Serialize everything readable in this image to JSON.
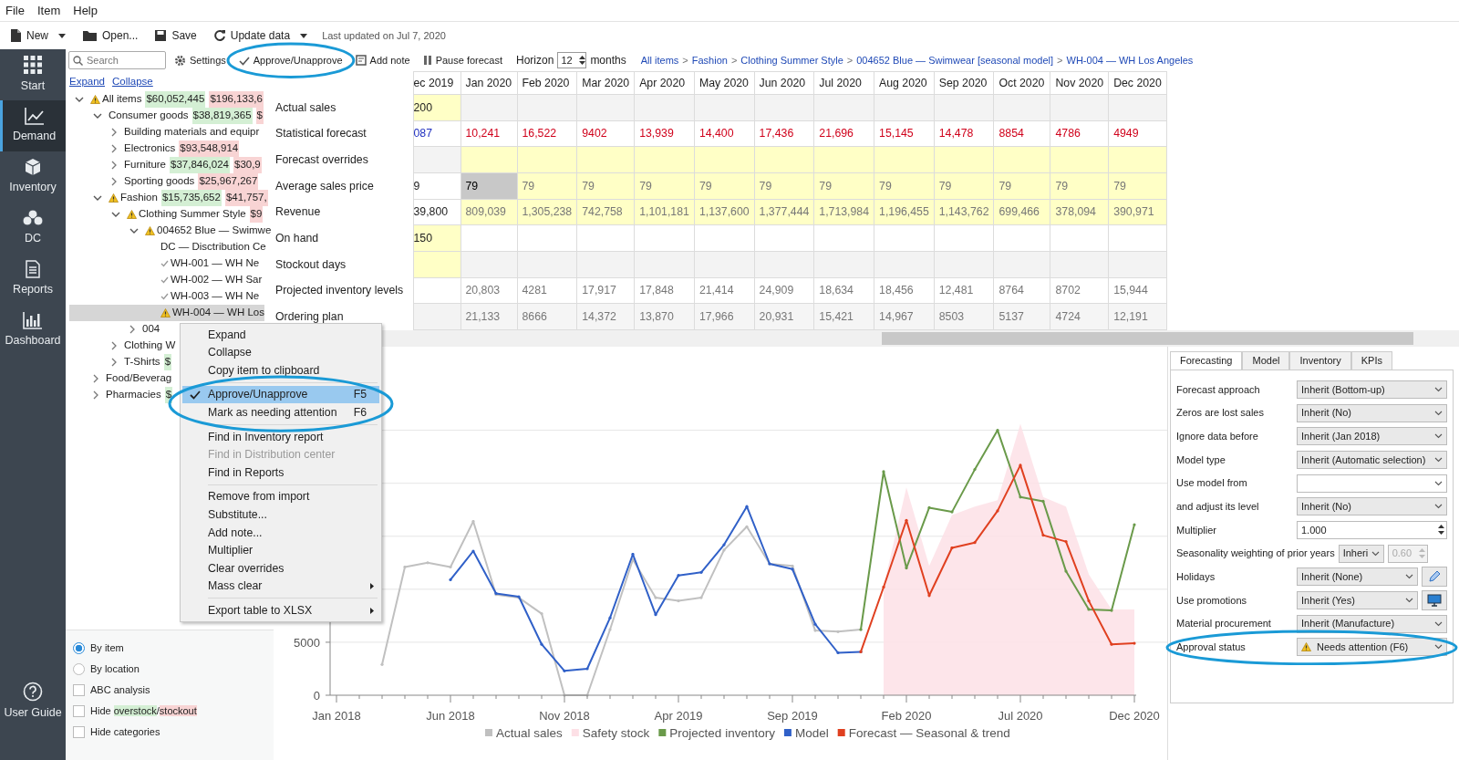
{
  "menu_bar": [
    "File",
    "Item",
    "Help"
  ],
  "toolbar": {
    "buttons": [
      {
        "label": "New",
        "dropdown": true
      },
      {
        "label": "Open...",
        "dropdown": false
      },
      {
        "label": "Save",
        "dropdown": false
      },
      {
        "label": "Update data",
        "dropdown": true
      }
    ],
    "last_updated": "Last updated on Jul 7, 2020"
  },
  "sidebar": {
    "items": [
      {
        "label": "Start",
        "selected": false
      },
      {
        "label": "Demand",
        "selected": true
      },
      {
        "label": "Inventory",
        "selected": false
      },
      {
        "label": "DC",
        "selected": false
      },
      {
        "label": "Reports",
        "selected": false
      },
      {
        "label": "Dashboard",
        "selected": false
      }
    ],
    "footer": {
      "label": "User Guide"
    }
  },
  "action_bar": {
    "search": {
      "placeholder": "Search"
    },
    "actions": [
      {
        "label": "Settings"
      },
      {
        "label": "Approve/Unapprove"
      },
      {
        "label": "Add note"
      },
      {
        "label": "Pause forecast"
      }
    ],
    "horizon": {
      "label": "Horizon",
      "value": "12",
      "unit": "months"
    },
    "breadcrumbs": [
      {
        "kind": "link",
        "text": "All items"
      },
      {
        "kind": "sep",
        "text": ">"
      },
      {
        "kind": "link",
        "text": "Fashion"
      },
      {
        "kind": "sep",
        "text": ">"
      },
      {
        "kind": "link",
        "text": "Clothing Summer Style"
      },
      {
        "kind": "sep",
        "text": ">"
      },
      {
        "kind": "link",
        "text": "004652 Blue — Swimwear [seasonal model]"
      },
      {
        "kind": "sep",
        "text": ">"
      },
      {
        "kind": "link",
        "text": "WH-004 — WH Los Angeles"
      }
    ]
  },
  "tree": {
    "links": [
      "Expand",
      "Collapse"
    ],
    "items": [
      {
        "label": "All items",
        "attention": true,
        "approved": false,
        "expanded": true,
        "selected": false,
        "badges": [
          {
            "text": "$60,052,445",
            "color": "#d4efd4"
          },
          {
            "text": "$196,133,6",
            "color": "#f8d4d4"
          }
        ],
        "children": [
          {
            "label": "Consumer goods",
            "attention": false,
            "approved": false,
            "expanded": true,
            "selected": false,
            "badges": [
              {
                "text": "$38,819,365",
                "color": "#d4efd4"
              },
              {
                "text": "$",
                "color": "#f8d4d4"
              }
            ],
            "children": [
              {
                "label": "Building materials and equipr",
                "attention": false,
                "approved": false,
                "expanded": false,
                "selected": false
              },
              {
                "label": "Electronics",
                "attention": false,
                "approved": false,
                "expanded": false,
                "selected": false,
                "badges": [
                  {
                    "text": "$93,548,914",
                    "color": "#f8d4d4"
                  }
                ]
              },
              {
                "label": "Furniture",
                "attention": false,
                "approved": false,
                "expanded": false,
                "selected": false,
                "badges": [
                  {
                    "text": "$37,846,024",
                    "color": "#d4efd4"
                  },
                  {
                    "text": "$30,9",
                    "color": "#f8d4d4"
                  }
                ]
              },
              {
                "label": "Sporting goods",
                "attention": false,
                "approved": false,
                "expanded": false,
                "selected": false,
                "badges": [
                  {
                    "text": "$25,967,267",
                    "color": "#f8d4d4"
                  }
                ]
              }
            ]
          },
          {
            "label": "Fashion",
            "attention": true,
            "approved": false,
            "expanded": true,
            "selected": false,
            "badges": [
              {
                "text": "$15,735,652",
                "color": "#d4efd4"
              },
              {
                "text": "$41,757,",
                "color": "#f8d4d4"
              }
            ],
            "children": [
              {
                "label": "Clothing Summer Style",
                "attention": true,
                "approved": false,
                "expanded": true,
                "selected": false,
                "badges": [
                  {
                    "text": "$9",
                    "color": "#f8d4d4"
                  }
                ],
                "children": [
                  {
                    "label": "004652 Blue — Swimwe",
                    "attention": true,
                    "approved": false,
                    "expanded": true,
                    "selected": false,
                    "children": [
                      {
                        "label": "DC — Disctribution Ce",
                        "attention": false,
                        "approved": false,
                        "selected": false
                      },
                      {
                        "label": "WH-001 — WH Ne",
                        "attention": false,
                        "approved": true,
                        "selected": false
                      },
                      {
                        "label": "WH-002 — WH Sar",
                        "attention": false,
                        "approved": true,
                        "selected": false
                      },
                      {
                        "label": "WH-003 — WH Ne",
                        "attention": false,
                        "approved": true,
                        "selected": false
                      },
                      {
                        "label": "WH-004 — WH Los",
                        "attention": true,
                        "approved": false,
                        "selected": true
                      }
                    ]
                  },
                  {
                    "label": "004",
                    "attention": false,
                    "approved": false,
                    "expanded": false,
                    "selected": false
                  }
                ]
              },
              {
                "label": "Clothing W",
                "attention": false,
                "approved": false,
                "expanded": false,
                "selected": false
              },
              {
                "label": "T-Shirts",
                "attention": false,
                "approved": false,
                "expanded": false,
                "selected": false,
                "badges": [
                  {
                    "text": "$",
                    "color": "#d4efd4"
                  }
                ]
              }
            ]
          },
          {
            "label": "Food/Beverag",
            "attention": false,
            "approved": false,
            "expanded": false,
            "selected": false
          },
          {
            "label": "Pharmacies",
            "attention": false,
            "approved": false,
            "expanded": false,
            "selected": false,
            "badges": [
              {
                "text": "$",
                "color": "#d4efd4"
              }
            ]
          }
        ]
      }
    ]
  },
  "view_options": [
    {
      "kind": "radio",
      "label": [
        {
          "text": "By item"
        }
      ],
      "checked": true
    },
    {
      "kind": "radio",
      "label": [
        {
          "text": "By location"
        }
      ],
      "checked": false
    },
    {
      "kind": "checkbox",
      "label": [
        {
          "text": "ABC analysis"
        }
      ],
      "checked": false
    },
    {
      "kind": "checkbox",
      "label": [
        {
          "text": "Hide "
        },
        {
          "text": "overstock",
          "color": "#d4efd4"
        },
        {
          "text": "/"
        },
        {
          "text": "stockout",
          "color": "#f8d4d4"
        }
      ],
      "checked": false
    },
    {
      "kind": "checkbox",
      "label": [
        {
          "text": "Hide categories"
        }
      ],
      "checked": false
    }
  ],
  "grid": {
    "columns": [
      "ec 2019",
      "Jan 2020",
      "Feb 2020",
      "Mar 2020",
      "Apr 2020",
      "May 2020",
      "Jun 2020",
      "Jul 2020",
      "Aug 2020",
      "Sep 2020",
      "Oct 2020",
      "Nov 2020",
      "Dec 2020"
    ],
    "rows": [
      {
        "label": "Actual sales",
        "kind": "actual",
        "cells": [
          {
            "text": "200",
            "selected": false
          },
          {
            "selected": false
          },
          {
            "selected": false
          },
          {
            "selected": false
          },
          {
            "selected": false
          },
          {
            "selected": false
          },
          {
            "selected": false
          },
          {
            "selected": false
          },
          {
            "selected": false
          },
          {
            "selected": false
          },
          {
            "selected": false
          },
          {
            "selected": false
          },
          {
            "selected": false
          }
        ]
      },
      {
        "label": "Statistical forecast",
        "kind": "forecast",
        "cells": [
          {
            "text": "087",
            "selected": false
          },
          {
            "text": "10,241",
            "selected": false
          },
          {
            "text": "16,522",
            "selected": false
          },
          {
            "text": "9402",
            "selected": false
          },
          {
            "text": "13,939",
            "selected": false
          },
          {
            "text": "14,400",
            "selected": false
          },
          {
            "text": "17,436",
            "selected": false
          },
          {
            "text": "21,696",
            "selected": false
          },
          {
            "text": "15,145",
            "selected": false
          },
          {
            "text": "14,478",
            "selected": false
          },
          {
            "text": "8854",
            "selected": false
          },
          {
            "text": "4786",
            "selected": false
          },
          {
            "text": "4949",
            "selected": false
          }
        ]
      },
      {
        "label": "Forecast overrides",
        "kind": "override",
        "cells": [
          {
            "selected": false
          },
          {
            "selected": false
          },
          {
            "selected": false
          },
          {
            "selected": false
          },
          {
            "selected": false
          },
          {
            "selected": false
          },
          {
            "selected": false
          },
          {
            "selected": false
          },
          {
            "selected": false
          },
          {
            "selected": false
          },
          {
            "selected": false
          },
          {
            "selected": false
          },
          {
            "selected": false
          }
        ]
      },
      {
        "label": "Average sales price",
        "kind": "price",
        "cells": [
          {
            "text": "9",
            "selected": false
          },
          {
            "text": "79",
            "selected": true
          },
          {
            "text": "79",
            "selected": false
          },
          {
            "text": "79",
            "selected": false
          },
          {
            "text": "79",
            "selected": false
          },
          {
            "text": "79",
            "selected": false
          },
          {
            "text": "79",
            "selected": false
          },
          {
            "text": "79",
            "selected": false
          },
          {
            "text": "79",
            "selected": false
          },
          {
            "text": "79",
            "selected": false
          },
          {
            "text": "79",
            "selected": false
          },
          {
            "text": "79",
            "selected": false
          },
          {
            "text": "79",
            "selected": false
          }
        ]
      },
      {
        "label": "Revenue",
        "kind": "revenue",
        "cells": [
          {
            "text": "39,800",
            "selected": false
          },
          {
            "text": "809,039",
            "selected": false
          },
          {
            "text": "1,305,238",
            "selected": false
          },
          {
            "text": "742,758",
            "selected": false
          },
          {
            "text": "1,101,181",
            "selected": false
          },
          {
            "text": "1,137,600",
            "selected": false
          },
          {
            "text": "1,377,444",
            "selected": false
          },
          {
            "text": "1,713,984",
            "selected": false
          },
          {
            "text": "1,196,455",
            "selected": false
          },
          {
            "text": "1,143,762",
            "selected": false
          },
          {
            "text": "699,466",
            "selected": false
          },
          {
            "text": "378,094",
            "selected": false
          },
          {
            "text": "390,971",
            "selected": false
          }
        ]
      },
      {
        "label": "On hand",
        "kind": "onhand",
        "cells": [
          {
            "text": "150",
            "selected": false
          },
          {
            "selected": false
          },
          {
            "selected": false
          },
          {
            "selected": false
          },
          {
            "selected": false
          },
          {
            "selected": false
          },
          {
            "selected": false
          },
          {
            "selected": false
          },
          {
            "selected": false
          },
          {
            "selected": false
          },
          {
            "selected": false
          },
          {
            "selected": false
          },
          {
            "selected": false
          }
        ]
      },
      {
        "label": "Stockout days",
        "kind": "stockout",
        "cells": [
          {
            "selected": false
          },
          {
            "selected": false
          },
          {
            "selected": false
          },
          {
            "selected": false
          },
          {
            "selected": false
          },
          {
            "selected": false
          },
          {
            "selected": false
          },
          {
            "selected": false
          },
          {
            "selected": false
          },
          {
            "selected": false
          },
          {
            "selected": false
          },
          {
            "selected": false
          },
          {
            "selected": false
          }
        ]
      },
      {
        "label": "Projected inventory levels",
        "kind": "projected",
        "cells": [
          {
            "selected": false
          },
          {
            "text": "20,803",
            "selected": false
          },
          {
            "text": "4281",
            "selected": false
          },
          {
            "text": "17,917",
            "selected": false
          },
          {
            "text": "17,848",
            "selected": false
          },
          {
            "text": "21,414",
            "selected": false
          },
          {
            "text": "24,909",
            "selected": false
          },
          {
            "text": "18,634",
            "selected": false
          },
          {
            "text": "18,456",
            "selected": false
          },
          {
            "text": "12,481",
            "selected": false
          },
          {
            "text": "8764",
            "selected": false
          },
          {
            "text": "8702",
            "selected": false
          },
          {
            "text": "15,944",
            "selected": false
          }
        ]
      },
      {
        "label": "Ordering plan",
        "kind": "ordering",
        "cells": [
          {
            "selected": false
          },
          {
            "text": "21,133",
            "selected": false
          },
          {
            "text": "8666",
            "selected": false
          },
          {
            "text": "14,372",
            "selected": false
          },
          {
            "text": "13,870",
            "selected": false
          },
          {
            "text": "17,966",
            "selected": false
          },
          {
            "text": "20,931",
            "selected": false
          },
          {
            "text": "15,421",
            "selected": false
          },
          {
            "text": "14,967",
            "selected": false
          },
          {
            "text": "8503",
            "selected": false
          },
          {
            "text": "5137",
            "selected": false
          },
          {
            "text": "4724",
            "selected": false
          },
          {
            "text": "12,191",
            "selected": false
          }
        ]
      }
    ]
  },
  "context_menu": {
    "items": [
      {
        "kind": "item",
        "label": "Expand",
        "checked": false,
        "selected": false,
        "disabled": false,
        "submenu": false
      },
      {
        "kind": "item",
        "label": "Collapse",
        "checked": false,
        "selected": false,
        "disabled": false,
        "submenu": false
      },
      {
        "kind": "item",
        "label": "Copy item to clipboard",
        "checked": false,
        "selected": false,
        "disabled": false,
        "submenu": false
      },
      {
        "kind": "separator"
      },
      {
        "kind": "item",
        "label": "Approve/Unapprove",
        "shortcut": "F5",
        "checked": true,
        "selected": true,
        "disabled": false,
        "submenu": false
      },
      {
        "kind": "item",
        "label": "Mark as needing attention",
        "shortcut": "F6",
        "checked": false,
        "selected": false,
        "disabled": false,
        "submenu": false
      },
      {
        "kind": "separator"
      },
      {
        "kind": "item",
        "label": "Find in Inventory report",
        "checked": false,
        "selected": false,
        "disabled": false,
        "submenu": false
      },
      {
        "kind": "item",
        "label": "Find in Distribution center",
        "checked": false,
        "selected": false,
        "disabled": true,
        "submenu": false
      },
      {
        "kind": "item",
        "label": "Find in Reports",
        "checked": false,
        "selected": false,
        "disabled": false,
        "submenu": false
      },
      {
        "kind": "separator"
      },
      {
        "kind": "item",
        "label": "Remove from import",
        "checked": false,
        "selected": false,
        "disabled": false,
        "submenu": false
      },
      {
        "kind": "item",
        "label": "Substitute...",
        "checked": false,
        "selected": false,
        "disabled": false,
        "submenu": false
      },
      {
        "kind": "item",
        "label": "Add note...",
        "checked": false,
        "selected": false,
        "disabled": false,
        "submenu": false
      },
      {
        "kind": "item",
        "label": "Multiplier",
        "checked": false,
        "selected": false,
        "disabled": false,
        "submenu": false
      },
      {
        "kind": "item",
        "label": "Clear overrides",
        "checked": false,
        "selected": false,
        "disabled": false,
        "submenu": false
      },
      {
        "kind": "item",
        "label": "Mass clear",
        "checked": false,
        "selected": false,
        "disabled": false,
        "submenu": true
      },
      {
        "kind": "separator"
      },
      {
        "kind": "item",
        "label": "Export table to XLSX",
        "checked": false,
        "selected": false,
        "disabled": false,
        "submenu": true
      }
    ]
  },
  "chart": {
    "chart_data": {
      "type": "line",
      "categories": [
        "Jan 2018",
        null,
        null,
        null,
        null,
        "Jun 2018",
        null,
        null,
        null,
        null,
        "Nov 2018",
        null,
        null,
        null,
        null,
        "Apr 2019",
        null,
        null,
        null,
        null,
        "Sep 2019",
        null,
        null,
        null,
        null,
        "Feb 2020",
        null,
        null,
        null,
        null,
        "Jul 2020",
        null,
        null,
        null,
        null,
        "Dec 2020"
      ],
      "ylim": [
        0,
        26000
      ],
      "yticks": [
        0,
        5000
      ],
      "legend": "bottom",
      "series": [
        {
          "name": "Actual sales",
          "color": "#c0c0c0",
          "type": "line",
          "values": [
            null,
            null,
            2900,
            12100,
            12500,
            12100,
            16400,
            9500,
            9200,
            7700,
            0,
            0,
            6200,
            12800,
            9200,
            8900,
            9200,
            13700,
            15900,
            12400,
            12200,
            6100,
            6000,
            6200,
            null,
            null,
            null,
            null,
            null,
            null,
            null,
            null,
            null,
            null,
            null,
            null
          ]
        },
        {
          "name": "Safety stock",
          "color": "#fde0e6",
          "type": "area",
          "values": [
            null,
            null,
            null,
            null,
            null,
            null,
            null,
            null,
            null,
            null,
            null,
            null,
            null,
            null,
            null,
            null,
            null,
            null,
            null,
            null,
            null,
            null,
            null,
            null,
            10300,
            19600,
            12200,
            17000,
            17800,
            18400,
            25600,
            18700,
            17800,
            11400,
            8100,
            8100
          ]
        },
        {
          "name": "Projected inventory",
          "color": "#6a9a4a",
          "type": "line",
          "values": [
            null,
            null,
            null,
            null,
            null,
            null,
            null,
            null,
            null,
            null,
            null,
            null,
            null,
            null,
            null,
            null,
            null,
            null,
            null,
            null,
            null,
            null,
            null,
            6200,
            21100,
            12000,
            17700,
            17300,
            21300,
            25000,
            18700,
            18300,
            11700,
            8100,
            8000,
            16100
          ]
        },
        {
          "name": "Model",
          "color": "#3060c8",
          "type": "line",
          "values": [
            null,
            null,
            null,
            null,
            null,
            10900,
            13600,
            9600,
            9300,
            4800,
            2300,
            2500,
            7300,
            13300,
            7600,
            11300,
            11600,
            14200,
            17800,
            12400,
            11900,
            6700,
            4000,
            4100,
            null,
            null,
            null,
            null,
            null,
            null,
            null,
            null,
            null,
            null,
            null,
            null
          ]
        },
        {
          "name": "Forecast — Seasonal & trend",
          "color": "#e04020",
          "type": "line",
          "values": [
            null,
            null,
            null,
            null,
            null,
            null,
            null,
            null,
            null,
            null,
            null,
            null,
            null,
            null,
            null,
            null,
            null,
            null,
            null,
            null,
            null,
            null,
            null,
            4100,
            10200,
            16500,
            9400,
            13900,
            14400,
            17400,
            21700,
            15100,
            14500,
            8900,
            4800,
            4900
          ]
        }
      ]
    }
  },
  "settings_panel": {
    "tabs": [
      {
        "label": "Forecasting",
        "selected": true
      },
      {
        "label": "Model",
        "selected": false
      },
      {
        "label": "Inventory",
        "selected": false
      },
      {
        "label": "KPIs",
        "selected": false
      }
    ],
    "fields": [
      {
        "label": "Forecast approach",
        "kind": "select",
        "value": "Inherit (Bottom-up)"
      },
      {
        "label": "Zeros are lost sales",
        "kind": "select",
        "value": "Inherit (No)"
      },
      {
        "label": "Ignore data before",
        "kind": "select",
        "value": "Inherit (Jan 2018)"
      },
      {
        "label": "Model type",
        "kind": "select",
        "value": "Inherit (Automatic selection)"
      },
      {
        "label": "Use model from",
        "kind": "select"
      },
      {
        "label": "and adjust its level",
        "kind": "select",
        "value": "Inherit (No)"
      },
      {
        "label": "Multiplier",
        "kind": "spin",
        "value": "1.000"
      },
      {
        "label": "Seasonality weighting of prior years",
        "kind": "select_spin",
        "value": "Inheri",
        "spin": {
          "value": "0.60",
          "disabled": true
        }
      },
      {
        "label": "Holidays",
        "kind": "select_edit",
        "value": "Inherit (None)"
      },
      {
        "label": "Use promotions",
        "kind": "select_screen",
        "value": "Inherit (Yes)"
      },
      {
        "label": "Material procurement",
        "kind": "select",
        "value": "Inherit (Manufacture)"
      },
      {
        "label": "Approval status",
        "kind": "select",
        "value": "Needs attention (F6)",
        "attention": true
      }
    ]
  },
  "annotations": [
    {
      "kind": "ellipse"
    },
    {
      "kind": "ellipse"
    },
    {
      "kind": "ellipse"
    }
  ]
}
